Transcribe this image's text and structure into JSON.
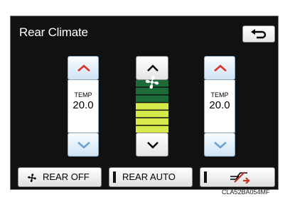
{
  "screen": {
    "title": "Rear Climate",
    "caption": "CLA52BA054MF"
  },
  "temperature": {
    "left": {
      "label": "TEMP",
      "value": "20.0"
    },
    "right": {
      "label": "TEMP",
      "value": "20.0"
    }
  },
  "fan": {
    "level": 4,
    "max_level": 7
  },
  "bottom": {
    "rear_off_label": "REAR OFF",
    "rear_auto_label": "REAR AUTO"
  },
  "colors": {
    "screen_bg": "#111111",
    "arrow_red": "#d8342c",
    "arrow_blue": "#6aa0d4",
    "fan_on": "#d8e94a",
    "fan_off": "#1e6b3a",
    "air_icon": "#c0362c"
  },
  "icons": {
    "back": "return-arrow-icon",
    "fan": "fan-icon",
    "airflow": "airflow-mode-icon"
  }
}
